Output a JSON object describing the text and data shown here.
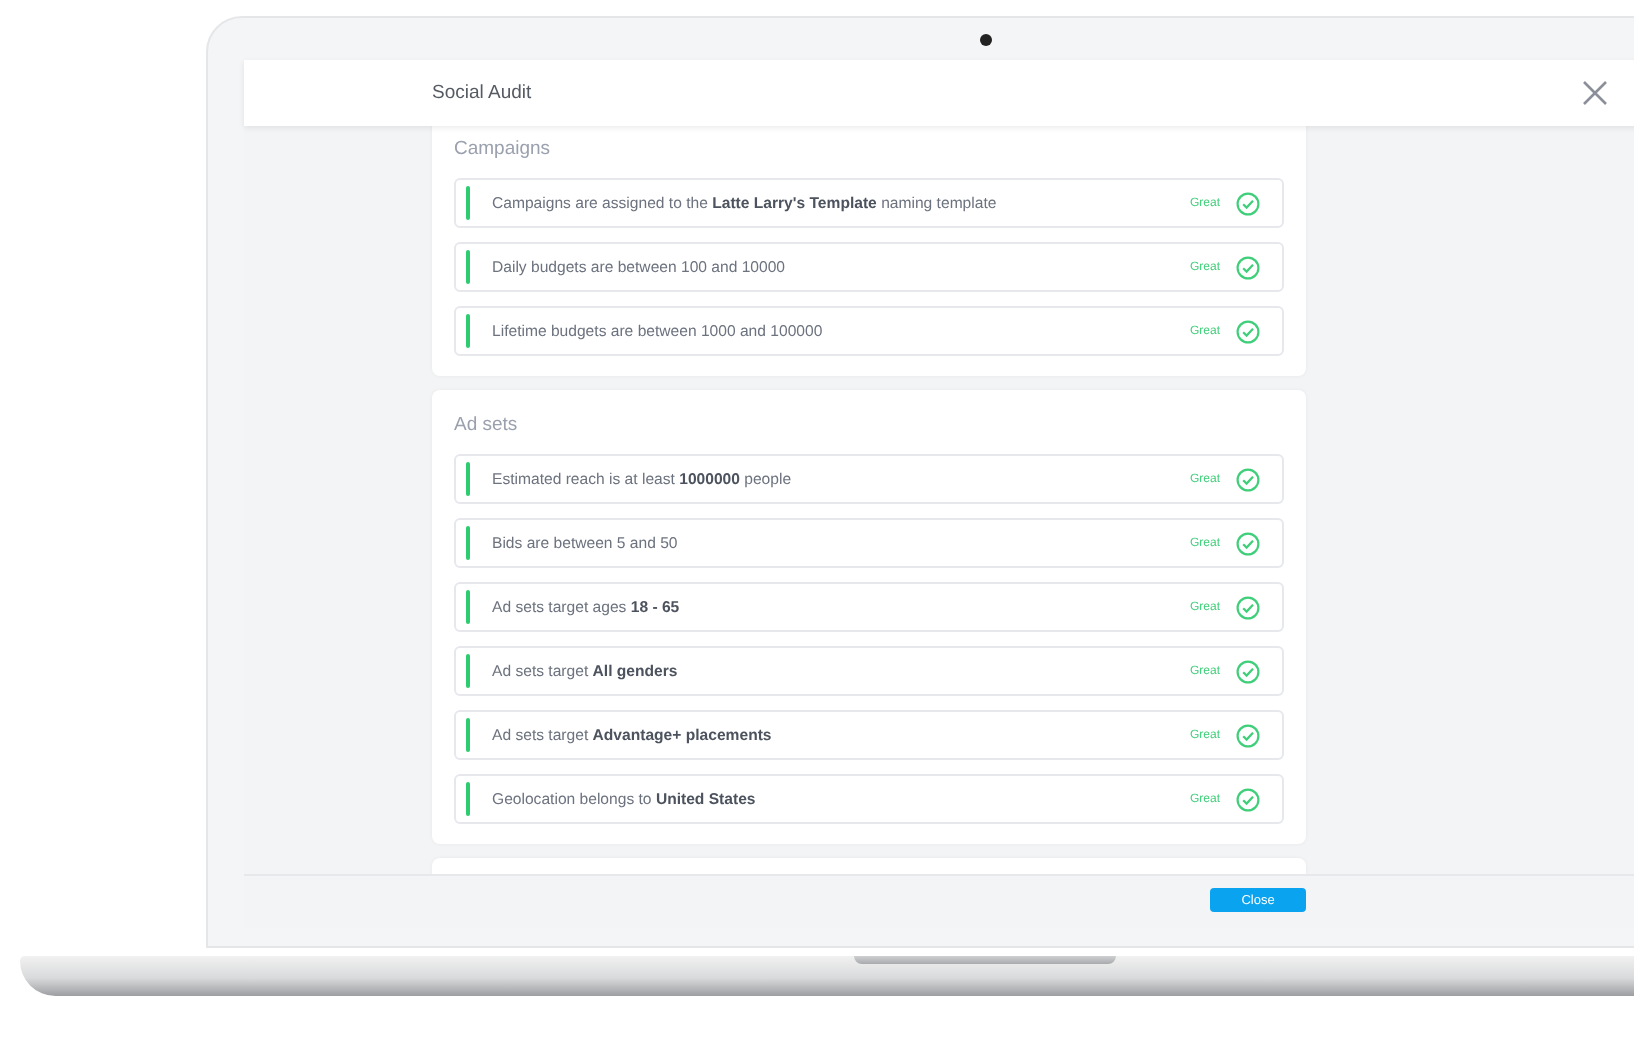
{
  "window": {
    "title": "Social Audit"
  },
  "sections": [
    {
      "title": "Campaigns",
      "rules": [
        {
          "text": "Campaigns are assigned to the **Latte Larry's Template** naming template",
          "status": "Great"
        },
        {
          "text": "Daily budgets are between 100 and 10000",
          "status": "Great"
        },
        {
          "text": "Lifetime budgets are between 1000 and 100000",
          "status": "Great"
        }
      ]
    },
    {
      "title": "Ad sets",
      "rules": [
        {
          "text": "Estimated reach is at least **1000000** people",
          "status": "Great"
        },
        {
          "text": "Bids are between 5 and 50",
          "status": "Great"
        },
        {
          "text": "Ad sets target ages **18 - 65**",
          "status": "Great"
        },
        {
          "text": "Ad sets target **All genders**",
          "status": "Great"
        },
        {
          "text": "Ad sets target **Advantage+ placements**",
          "status": "Great"
        },
        {
          "text": "Geolocation belongs to **United States**",
          "status": "Great"
        }
      ]
    }
  ],
  "footer": {
    "button": "Close"
  }
}
